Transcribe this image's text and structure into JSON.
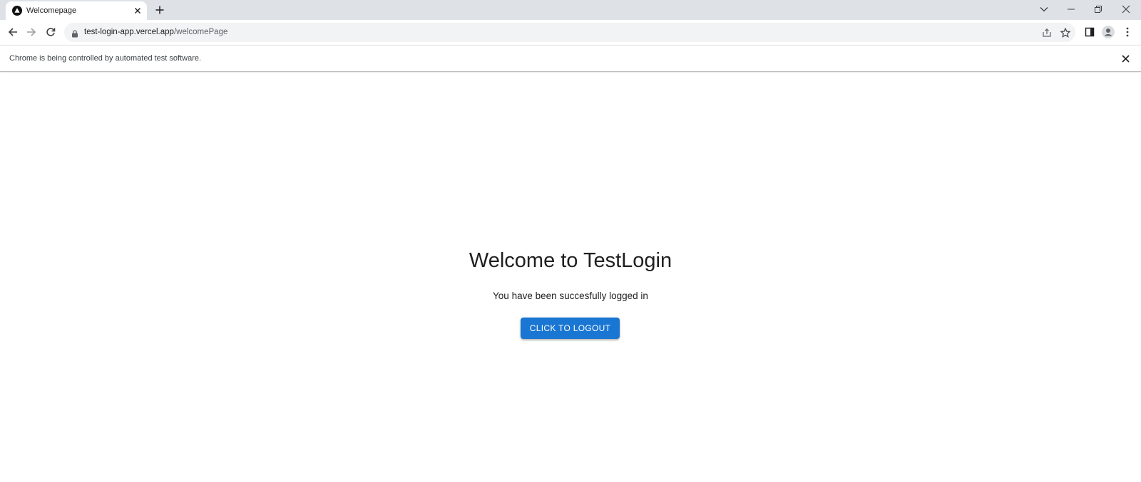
{
  "browser": {
    "tab": {
      "title": "Welcomepage",
      "favicon": "vercel-triangle-icon"
    },
    "address_bar": {
      "host": "test-login-app.vercel.app",
      "path": "/welcomePage"
    },
    "infobar": {
      "message": "Chrome is being controlled by automated test software."
    },
    "icons": {
      "back": "arrow-left-icon",
      "forward": "arrow-right-icon",
      "reload": "reload-icon",
      "share": "share-icon",
      "bookmark": "star-icon",
      "side_panel": "side-panel-icon",
      "profile": "avatar-icon",
      "menu": "kebab-menu-icon"
    }
  },
  "page": {
    "title": "Welcome to TestLogin",
    "subtitle": "You have been succesfully logged in",
    "logout_button": "CLICK TO LOGOUT"
  },
  "colors": {
    "primary_button": "#1976d2",
    "tabstrip": "#dee1e6",
    "omnibox": "#f1f3f4"
  }
}
